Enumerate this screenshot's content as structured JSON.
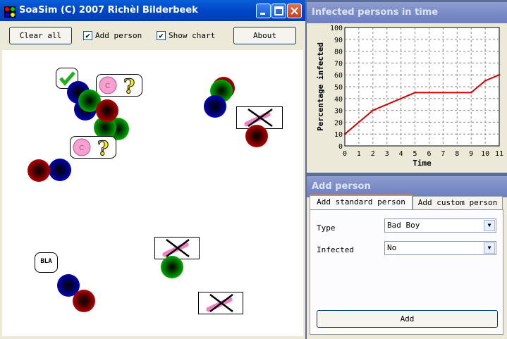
{
  "main_window": {
    "title": "SoaSim (C) 2007 Richèl Bilderbeek",
    "toolbar": {
      "clear_all": "Clear all",
      "add_person": "Add person",
      "add_person_checked": true,
      "show_chart": "Show chart",
      "show_chart_checked": true,
      "about": "About"
    },
    "speech": {
      "bla": "BLA"
    }
  },
  "chart_window": {
    "title": "Infected persons in time"
  },
  "chart_data": {
    "type": "line",
    "xlabel": "Time",
    "ylabel": "Percentage infected",
    "x": [
      0,
      1,
      2,
      3,
      4,
      5,
      6,
      7,
      8,
      9,
      10,
      11
    ],
    "series": [
      {
        "values": [
          10,
          20,
          30,
          35,
          40,
          45,
          45,
          45,
          45,
          45,
          55,
          60
        ]
      }
    ],
    "xlim": [
      0,
      11
    ],
    "ylim": [
      0,
      100
    ],
    "xticks": [
      "0",
      "1",
      "2",
      "3",
      "4",
      "5",
      "6",
      "7",
      "8",
      "9",
      "10",
      "11"
    ],
    "yticks": [
      "0",
      "10",
      "20",
      "30",
      "40",
      "50",
      "60",
      "70",
      "80",
      "90",
      "100"
    ],
    "grid": true,
    "line_color": "#d00000"
  },
  "add_window": {
    "title": "Add person",
    "tabs": [
      "Add standard person",
      "Add custom person"
    ],
    "type_label": "Type",
    "type_value": "Bad Boy",
    "infected_label": "Infected",
    "infected_value": "No",
    "add_button": "Add"
  },
  "icons": {
    "app": "traffic-light-icon",
    "minimize": "minimize-icon",
    "maximize": "maximize-icon",
    "close": "close-icon"
  }
}
